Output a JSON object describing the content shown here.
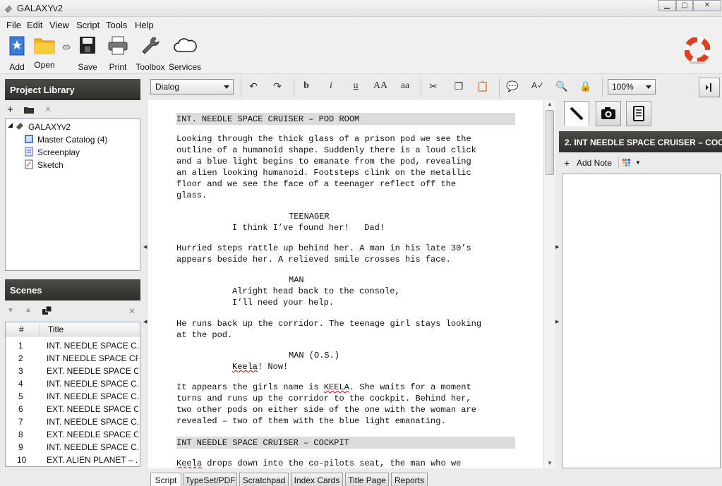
{
  "window": {
    "title": "GALAXYv2"
  },
  "menu": [
    "File",
    "Edit",
    "View",
    "Script",
    "Tools",
    "Help"
  ],
  "toolbar": {
    "add": "Add",
    "open": "Open",
    "save": "Save",
    "print": "Print",
    "toolbox": "Toolbox",
    "services": "Services"
  },
  "project_library": {
    "title": "Project Library",
    "root": "GALAXYv2",
    "items": [
      "Master Catalog (4)",
      "Screenplay",
      "Sketch"
    ]
  },
  "scenes": {
    "title": "Scenes",
    "columns": [
      "#",
      "Title"
    ],
    "rows": [
      {
        "n": "1",
        "title": "INT. NEEDLE SPACE C..."
      },
      {
        "n": "2",
        "title": "INT NEEDLE SPACE CR..."
      },
      {
        "n": "3",
        "title": "EXT. NEEDLE SPACE C..."
      },
      {
        "n": "4",
        "title": "INT. NEEDLE SPACE C..."
      },
      {
        "n": "5",
        "title": "INT. NEEDLE SPACE C..."
      },
      {
        "n": "6",
        "title": "EXT. NEEDLE SPACE C..."
      },
      {
        "n": "7",
        "title": "INT. NEEDLE SPACE C..."
      },
      {
        "n": "8",
        "title": "EXT. NEEDLE SPACE C..."
      },
      {
        "n": "9",
        "title": "INT. NEEDLE SPACE C..."
      },
      {
        "n": "10",
        "title": "EXT. ALIEN PLANET – ..."
      }
    ]
  },
  "editor": {
    "style": "Dialog",
    "zoom": "100%",
    "format": {
      "bold": "b",
      "italic": "i",
      "underline": "u",
      "upper": "AA",
      "lower": "aa"
    }
  },
  "script": {
    "scene1": "INT. NEEDLE SPACE CRUISER – POD ROOM",
    "action1": [
      "Looking through the thick glass of a prison pod we see the",
      "outline of a humanoid shape. Suddenly there is a loud click",
      "and a blue light begins to emanate from the pod, revealing",
      "an alien looking humanoid. Footsteps clink on the metallic",
      "floor and we see the face of a teenager reflect off the",
      "glass."
    ],
    "char1": "TEENAGER",
    "dialog1": "I think I’ve found her!   Dad!",
    "action2": [
      "Hurried steps rattle up behind her. A man in his late 30’s",
      "appears beside her. A relieved smile crosses his face."
    ],
    "char2": "MAN",
    "dialog2": [
      "Alright head back to the console,",
      "I’ll need your help."
    ],
    "action3": [
      "He runs back up the corridor. The teenage girl stays looking",
      "at the pod."
    ],
    "char3": "MAN (O.S.)",
    "dialog3_name": "Keela",
    "dialog3_rest": "! Now!",
    "action4_l1_pre": "It appears the girls name is ",
    "action4_l1_name": "KEELA",
    "action4_l1_post": ". She waits for a moment",
    "action4": [
      "turns and runs up the corridor to the cockpit. Behind her,",
      "two other pods on either side of the one with the woman are",
      "revealed – two of them with the blue light emanating."
    ],
    "scene2": "INT NEEDLE SPACE CRUISER – COCKPIT",
    "action5_name": "Keela",
    "action5_rest": " drops down into the co-pilots seat, the man who we"
  },
  "notes": {
    "heading": "2. INT NEEDLE SPACE CRUISER – COC...",
    "add_note": "Add Note"
  },
  "bottom_tabs": [
    "Script",
    "TypeSet/PDF",
    "Scratchpad",
    "Index Cards",
    "Title Page",
    "Reports"
  ],
  "colors": {
    "panel_header": "#3c3b39",
    "slugline_bg": "#dcdcdc",
    "help_ring": "#e0401f"
  }
}
